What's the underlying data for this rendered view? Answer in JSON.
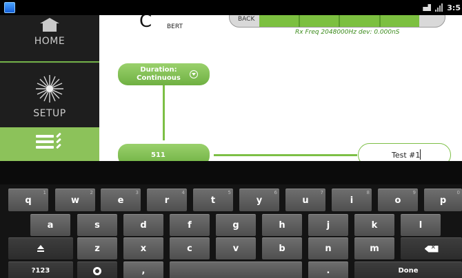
{
  "status_bar": {
    "time": "3:5",
    "app_icon": "app-icon",
    "icons": [
      "notification-icon",
      "signal-icon"
    ]
  },
  "sidebar": {
    "items": [
      {
        "label": "HOME",
        "icon": "home-icon"
      },
      {
        "label": "SETUP",
        "icon": "starburst-icon"
      },
      {
        "label": "",
        "icon": "checklist-icon",
        "active": true
      }
    ]
  },
  "main": {
    "logo_letter": "C",
    "bert_label": "BERT",
    "back_label": "BACK",
    "rx_freq": "Rx Freq 2048000Hz dev: 0.000nS",
    "duration": {
      "line1": "Duration:",
      "line2": "Continuous"
    },
    "pattern": "511",
    "test_name": "Test #1"
  },
  "keyboard": {
    "row1": [
      {
        "label": "q",
        "hint": "1"
      },
      {
        "label": "w",
        "hint": "2"
      },
      {
        "label": "e",
        "hint": "3"
      },
      {
        "label": "r",
        "hint": "4"
      },
      {
        "label": "t",
        "hint": "5"
      },
      {
        "label": "y",
        "hint": "6"
      },
      {
        "label": "u",
        "hint": "7"
      },
      {
        "label": "i",
        "hint": "8"
      },
      {
        "label": "o",
        "hint": "9"
      },
      {
        "label": "p",
        "hint": "0"
      }
    ],
    "row2": [
      "a",
      "s",
      "d",
      "f",
      "g",
      "h",
      "j",
      "k",
      "l"
    ],
    "row3": [
      "z",
      "x",
      "c",
      "v",
      "b",
      "n",
      "m"
    ],
    "symbols_label": "?123",
    "comma": ",",
    "period": ".",
    "done_label": "Done"
  },
  "colors": {
    "accent_green": "#7cbf45",
    "sidebar_bg": "#222222",
    "keyboard_bg": "#141414"
  }
}
